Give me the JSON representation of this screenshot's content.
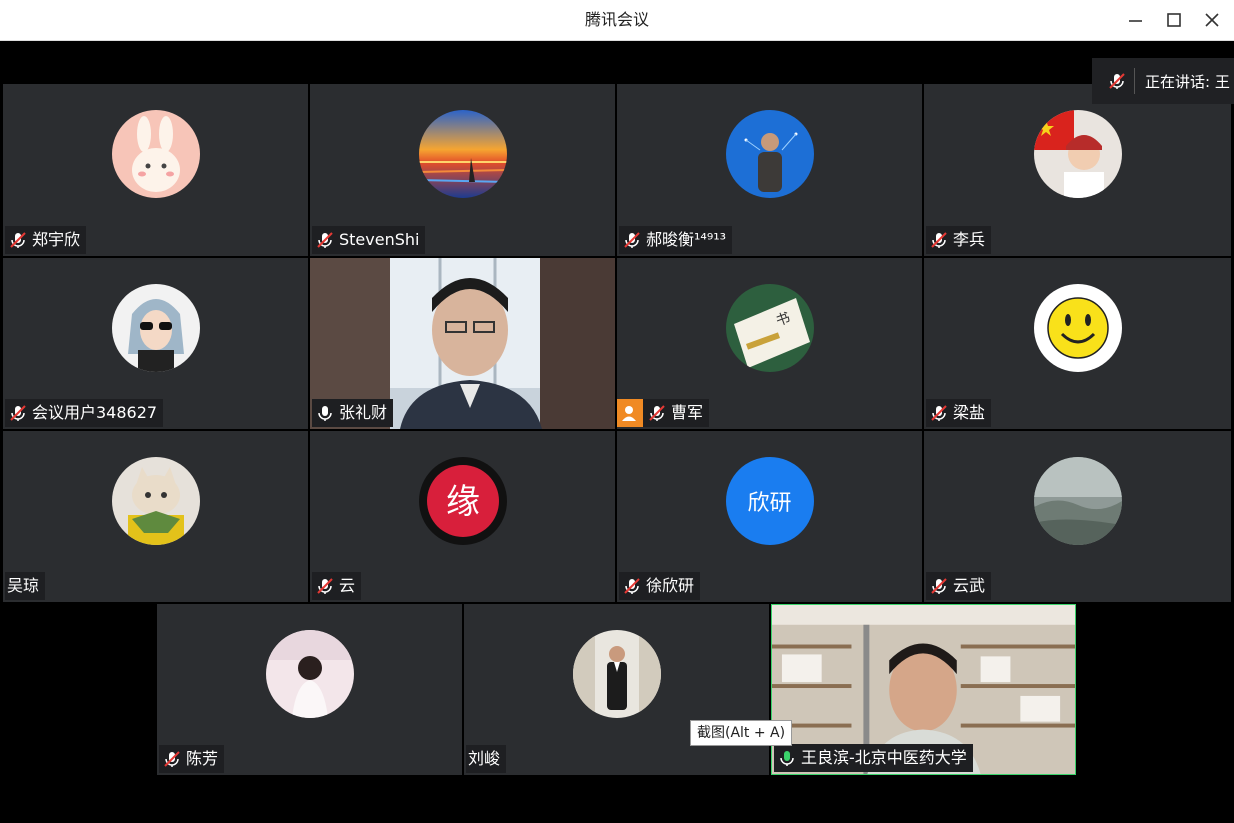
{
  "window": {
    "title": "腾讯会议"
  },
  "speaking": {
    "text": "正在讲话: 王"
  },
  "tooltip": {
    "text": "截图(Alt + A)"
  },
  "participants": [
    {
      "name": "郑宇欣",
      "muted": true,
      "avatar": "rabbit-avatar"
    },
    {
      "name": "StevenShi",
      "muted": true,
      "avatar": "sunset-avatar"
    },
    {
      "name": "郝晙衡¹⁴⁹¹³",
      "muted": true,
      "avatar": "man-blue-avatar"
    },
    {
      "name": "李兵",
      "muted": true,
      "avatar": "girl-flag-avatar"
    },
    {
      "name": "会议用户348627",
      "muted": true,
      "avatar": "woman-sunglasses-avatar"
    },
    {
      "name": "张礼财",
      "muted": false,
      "avatar": "video"
    },
    {
      "name": "曹军",
      "muted": true,
      "avatar": "calligraphy-avatar",
      "host_badge": true
    },
    {
      "name": "梁盐",
      "muted": true,
      "avatar": "smiley-avatar"
    },
    {
      "name": "吴琼",
      "muted": false,
      "avatar": "cat-avatar",
      "no_mic": true
    },
    {
      "name": "云",
      "muted": true,
      "avatar": "yuan-logo-avatar"
    },
    {
      "name": "徐欣研",
      "muted": true,
      "avatar": "text-avatar",
      "avatar_text": "欣研",
      "avatar_color": "#1a7df0"
    },
    {
      "name": "云武",
      "muted": true,
      "avatar": "landscape-avatar"
    },
    {
      "name": "陈芳",
      "muted": true,
      "avatar": "girl-back-avatar"
    },
    {
      "name": "刘峻",
      "muted": false,
      "avatar": "man-suit-avatar",
      "no_mic": true
    },
    {
      "name": "王良滨-北京中医药大学",
      "muted": false,
      "avatar": "video",
      "speaking": true
    }
  ],
  "colors": {
    "tile": "#2b2d30",
    "nametag": "#1e1f22",
    "speaking_border": "#3ad36b",
    "host_badge": "#f08a24"
  }
}
